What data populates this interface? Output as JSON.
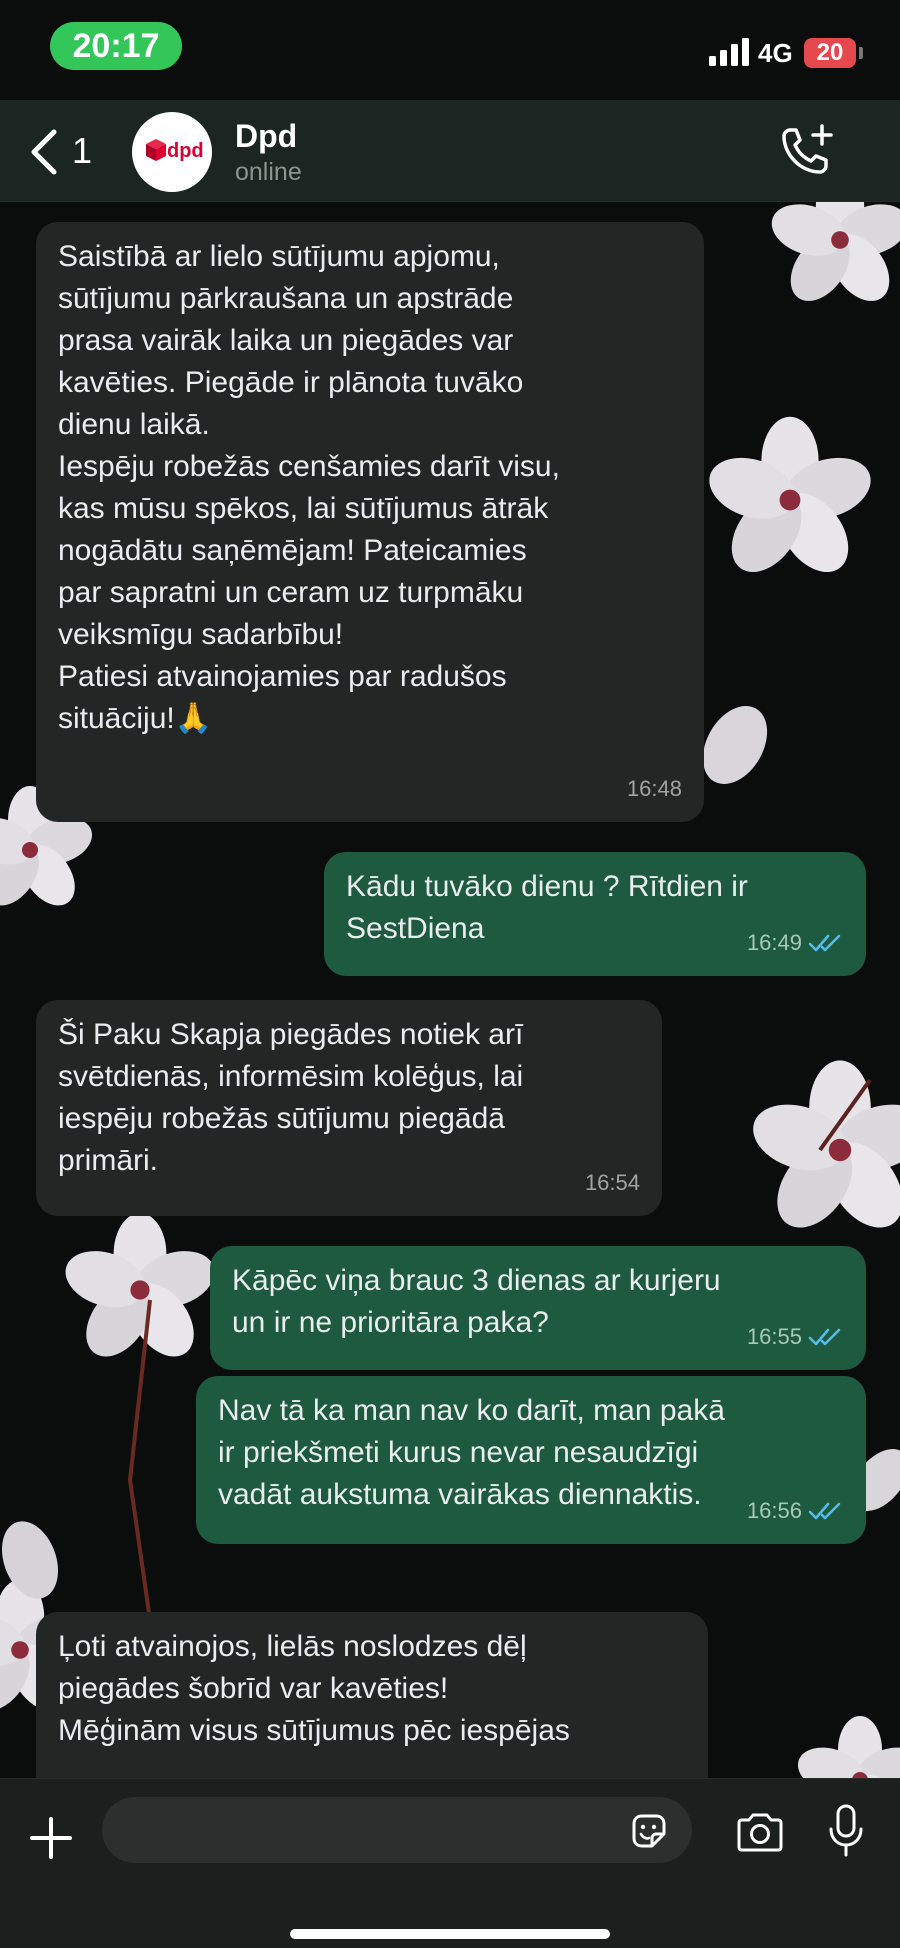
{
  "status_bar": {
    "time": "20:17",
    "network": "4G",
    "battery": "20"
  },
  "header": {
    "back_count": "1",
    "avatar_text": "dpd",
    "contact_name": "Dpd",
    "contact_status": "online"
  },
  "messages": [
    {
      "direction": "incoming",
      "text": "Saistībā ar lielo sūtījumu apjomu,\nsūtījumu pārkraušana un apstrāde\nprasa vairāk laika un piegādes var\nkavēties. Piegāde ir plānota tuvāko\ndienu laikā.\nIespēju robežās cenšamies darīt visu,\nkas mūsu spēkos, lai sūtījumus ātrāk\nnogādātu saņēmējam! Pateicamies\npar sapratni un ceram uz turpmāku\nveiksmīgu sadarbību!\nPatiesi atvainojamies par radušos\nsituāciju!🙏",
      "time": "16:48"
    },
    {
      "direction": "outgoing",
      "text": "Kādu tuvāko dienu ? Rītdien ir\nSestDiena",
      "time": "16:49"
    },
    {
      "direction": "incoming",
      "text": "Ši Paku Skapja piegādes notiek arī\nsvētdienās, informēsim kolēģus, lai\niespēju robežās sūtījumu piegādā\nprimāri.",
      "time": "16:54"
    },
    {
      "direction": "outgoing",
      "text": "Kāpēc viņa brauc 3 dienas ar kurjeru\nun ir ne prioritāra paka?",
      "time": "16:55"
    },
    {
      "direction": "outgoing",
      "text": "Nav tā ka man nav ko darīt, man pakā\nir priekšmeti kurus nevar nesaudzīgi\nvadāt aukstuma vairākas diennaktis.",
      "time": "16:56"
    },
    {
      "direction": "incoming",
      "text": "Ļoti atvainojos, lielās noslodzes dēļ\npiegādes šobrīd var kavēties!\nMēģinām visus sūtījumus pēc iespējas",
      "time": ""
    }
  ],
  "input": {
    "value": "",
    "placeholder": ""
  },
  "icons": {
    "back": "chevron-left-icon",
    "call": "add-call-icon",
    "plus": "plus-icon",
    "sticker": "sticker-icon",
    "camera": "camera-icon",
    "mic": "microphone-icon",
    "read_receipt": "double-check-icon"
  },
  "colors": {
    "time_pill": "#33c75a",
    "battery": "#e5484d",
    "incoming_bubble": "#222625",
    "outgoing_bubble": "#1d5a3f",
    "read_ticks": "#53bdeb",
    "header": "#1b2521"
  }
}
